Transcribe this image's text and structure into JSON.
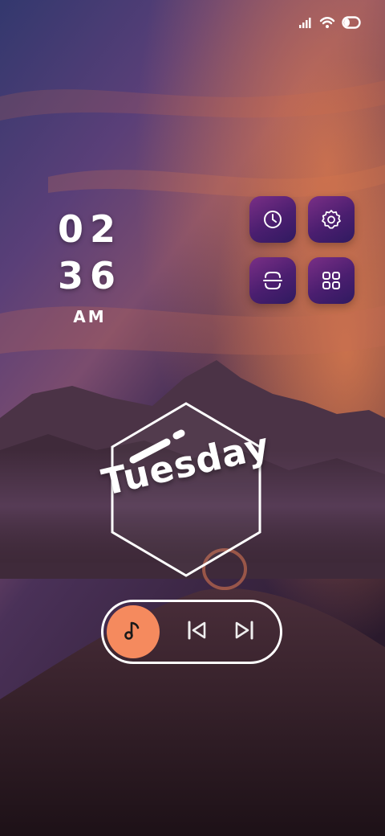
{
  "status_bar": {
    "icons": [
      "signal-icon",
      "wifi-icon",
      "battery-icon"
    ]
  },
  "clock": {
    "hours": "02",
    "minutes": "36",
    "period": "AM"
  },
  "app_tiles": [
    {
      "name": "clock-app",
      "icon": "clock-icon"
    },
    {
      "name": "settings-app",
      "icon": "gear-icon"
    },
    {
      "name": "scanner-app",
      "icon": "scan-icon"
    },
    {
      "name": "apps-drawer",
      "icon": "grid-icon"
    }
  ],
  "day_widget": {
    "day": "Tuesday"
  },
  "music_widget": {
    "icons": [
      "music-note-icon",
      "previous-track-icon",
      "next-track-icon"
    ],
    "accent_color": "#f58a5e"
  },
  "colors": {
    "tile_gradient_start": "#7a2f86",
    "tile_gradient_end": "#2f1a60",
    "sky_top": "#3a2f6e",
    "sky_glow": "#e3744a"
  }
}
